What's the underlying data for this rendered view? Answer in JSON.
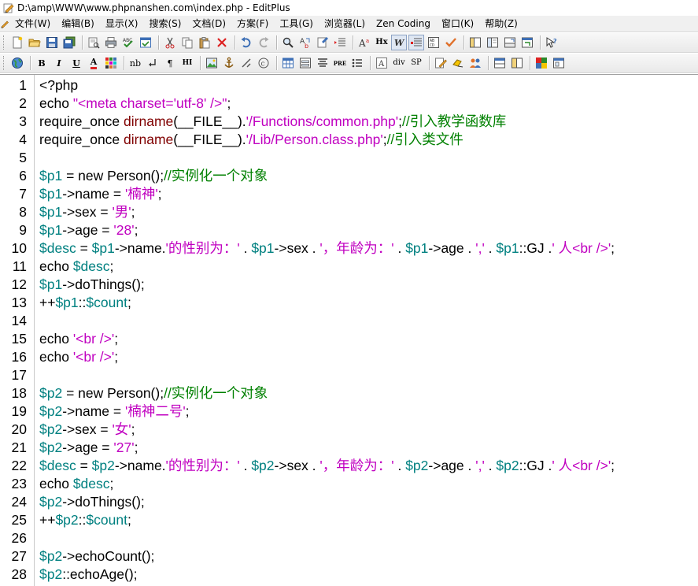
{
  "window": {
    "title": "D:\\amp\\WWW\\www.phpnanshen.com\\index.php - EditPlus"
  },
  "menu": [
    "文件(W)",
    "编辑(B)",
    "显示(X)",
    "搜索(S)",
    "文档(D)",
    "方案(F)",
    "工具(G)",
    "浏览器(L)",
    "Zen Coding",
    "窗口(K)",
    "帮助(Z)"
  ],
  "toolbar2_glyphs": {
    "bold": "B",
    "italic": "I",
    "underline": "U",
    "fontcolor": "A",
    "nbsp": "nb",
    "para": "¶",
    "hi": "HI",
    "pre": "PRE",
    "div": "div",
    "sp": "SP",
    "heading": "Hx"
  },
  "colors": {
    "variable": "#008080",
    "string": "#c000c0",
    "function": "#800000",
    "comment": "#008000",
    "keyword": "#000000"
  },
  "code_lines": [
    {
      "n": "1",
      "tokens": [
        [
          "k",
          "<?php"
        ]
      ]
    },
    {
      "n": "2",
      "tokens": [
        [
          "k",
          "echo "
        ],
        [
          "s",
          "\"<meta charset='utf-8' />\""
        ],
        [
          "k",
          ";"
        ]
      ]
    },
    {
      "n": "3",
      "tokens": [
        [
          "k",
          "require_once "
        ],
        [
          "f",
          "dirname"
        ],
        [
          "k",
          "(__FILE__)."
        ],
        [
          "s",
          "'/Functions/common.php'"
        ],
        [
          "k",
          ";"
        ],
        [
          "c",
          "//引入教学函数库"
        ]
      ]
    },
    {
      "n": "4",
      "tokens": [
        [
          "k",
          "require_once "
        ],
        [
          "f",
          "dirname"
        ],
        [
          "k",
          "(__FILE__)."
        ],
        [
          "s",
          "'/Lib/Person.class.php'"
        ],
        [
          "k",
          ";"
        ],
        [
          "c",
          "//引入类文件"
        ]
      ]
    },
    {
      "n": "5",
      "tokens": []
    },
    {
      "n": "6",
      "tokens": [
        [
          "v",
          "$p1"
        ],
        [
          "k",
          " = new Person();"
        ],
        [
          "c",
          "//实例化一个对象"
        ]
      ]
    },
    {
      "n": "7",
      "tokens": [
        [
          "v",
          "$p1"
        ],
        [
          "k",
          "->name = "
        ],
        [
          "s",
          "'楠神'"
        ],
        [
          "k",
          ";"
        ]
      ]
    },
    {
      "n": "8",
      "tokens": [
        [
          "v",
          "$p1"
        ],
        [
          "k",
          "->sex = "
        ],
        [
          "s",
          "'男'"
        ],
        [
          "k",
          ";"
        ]
      ]
    },
    {
      "n": "9",
      "tokens": [
        [
          "v",
          "$p1"
        ],
        [
          "k",
          "->age = "
        ],
        [
          "s",
          "'28'"
        ],
        [
          "k",
          ";"
        ]
      ]
    },
    {
      "n": "10",
      "tokens": [
        [
          "v",
          "$desc"
        ],
        [
          "k",
          " = "
        ],
        [
          "v",
          "$p1"
        ],
        [
          "k",
          "->name."
        ],
        [
          "s",
          "'的性别为：'"
        ],
        [
          "k",
          " . "
        ],
        [
          "v",
          "$p1"
        ],
        [
          "k",
          "->sex . "
        ],
        [
          "s",
          "'，年龄为：'"
        ],
        [
          "k",
          " . "
        ],
        [
          "v",
          "$p1"
        ],
        [
          "k",
          "->age . "
        ],
        [
          "s",
          "','"
        ],
        [
          "k",
          " . "
        ],
        [
          "v",
          "$p1"
        ],
        [
          "k",
          "::GJ ."
        ],
        [
          "s",
          "' 人<br />'"
        ],
        [
          "k",
          ";"
        ]
      ]
    },
    {
      "n": "11",
      "tokens": [
        [
          "k",
          "echo "
        ],
        [
          "v",
          "$desc"
        ],
        [
          "k",
          ";"
        ]
      ]
    },
    {
      "n": "12",
      "tokens": [
        [
          "v",
          "$p1"
        ],
        [
          "k",
          "->doThings();"
        ]
      ]
    },
    {
      "n": "13",
      "tokens": [
        [
          "k",
          "++"
        ],
        [
          "v",
          "$p1"
        ],
        [
          "k",
          "::"
        ],
        [
          "v",
          "$count"
        ],
        [
          "k",
          ";"
        ]
      ]
    },
    {
      "n": "14",
      "tokens": []
    },
    {
      "n": "15",
      "tokens": [
        [
          "k",
          "echo "
        ],
        [
          "s",
          "'<br />'"
        ],
        [
          "k",
          ";"
        ]
      ]
    },
    {
      "n": "16",
      "tokens": [
        [
          "k",
          "echo "
        ],
        [
          "s",
          "'<br />'"
        ],
        [
          "k",
          ";"
        ]
      ]
    },
    {
      "n": "17",
      "tokens": []
    },
    {
      "n": "18",
      "tokens": [
        [
          "v",
          "$p2"
        ],
        [
          "k",
          " = new Person();"
        ],
        [
          "c",
          "//实例化一个对象"
        ]
      ]
    },
    {
      "n": "19",
      "tokens": [
        [
          "v",
          "$p2"
        ],
        [
          "k",
          "->name = "
        ],
        [
          "s",
          "'楠神二号'"
        ],
        [
          "k",
          ";"
        ]
      ]
    },
    {
      "n": "20",
      "tokens": [
        [
          "v",
          "$p2"
        ],
        [
          "k",
          "->sex = "
        ],
        [
          "s",
          "'女'"
        ],
        [
          "k",
          ";"
        ]
      ]
    },
    {
      "n": "21",
      "tokens": [
        [
          "v",
          "$p2"
        ],
        [
          "k",
          "->age = "
        ],
        [
          "s",
          "'27'"
        ],
        [
          "k",
          ";"
        ]
      ]
    },
    {
      "n": "22",
      "tokens": [
        [
          "v",
          "$desc"
        ],
        [
          "k",
          " = "
        ],
        [
          "v",
          "$p2"
        ],
        [
          "k",
          "->name."
        ],
        [
          "s",
          "'的性别为：'"
        ],
        [
          "k",
          " . "
        ],
        [
          "v",
          "$p2"
        ],
        [
          "k",
          "->sex . "
        ],
        [
          "s",
          "'，年龄为：'"
        ],
        [
          "k",
          " . "
        ],
        [
          "v",
          "$p2"
        ],
        [
          "k",
          "->age . "
        ],
        [
          "s",
          "','"
        ],
        [
          "k",
          " . "
        ],
        [
          "v",
          "$p2"
        ],
        [
          "k",
          "::GJ ."
        ],
        [
          "s",
          "' 人<br />'"
        ],
        [
          "k",
          ";"
        ]
      ]
    },
    {
      "n": "23",
      "tokens": [
        [
          "k",
          "echo "
        ],
        [
          "v",
          "$desc"
        ],
        [
          "k",
          ";"
        ]
      ]
    },
    {
      "n": "24",
      "tokens": [
        [
          "v",
          "$p2"
        ],
        [
          "k",
          "->doThings();"
        ]
      ]
    },
    {
      "n": "25",
      "tokens": [
        [
          "k",
          "++"
        ],
        [
          "v",
          "$p2"
        ],
        [
          "k",
          "::"
        ],
        [
          "v",
          "$count"
        ],
        [
          "k",
          ";"
        ]
      ]
    },
    {
      "n": "26",
      "tokens": []
    },
    {
      "n": "27",
      "tokens": [
        [
          "v",
          "$p2"
        ],
        [
          "k",
          "->echoCount();"
        ]
      ]
    },
    {
      "n": "28",
      "tokens": [
        [
          "v",
          "$p2"
        ],
        [
          "k",
          "::echoAge();"
        ]
      ]
    }
  ]
}
